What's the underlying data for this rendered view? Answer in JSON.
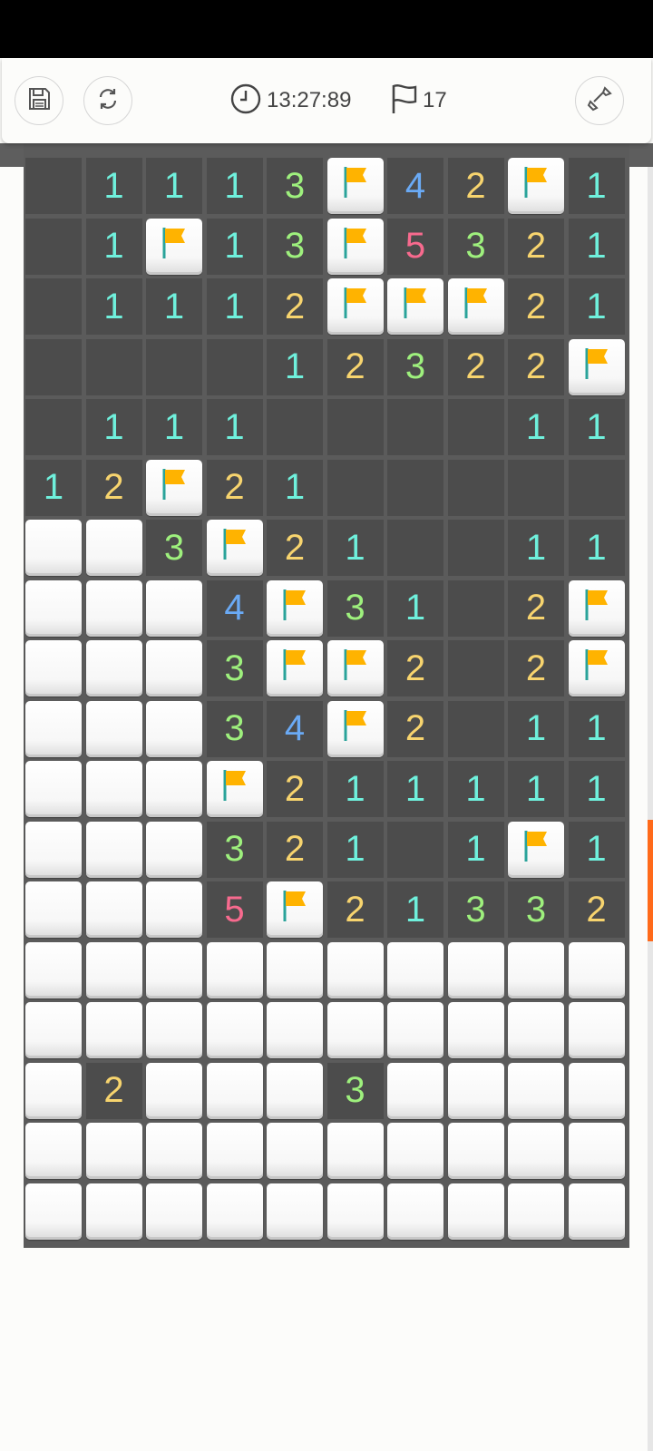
{
  "toolbar": {
    "time": "13:27:89",
    "flag_count": "17"
  },
  "colors": {
    "n1": "#6ff0dc",
    "n2": "#f7d46e",
    "n3": "#9ef07d",
    "n4": "#6aaaf5",
    "n5": "#f76a8e",
    "flag": "#ffb300",
    "revealed": "#4c4c4c",
    "grid": "#5b5b5b",
    "scroll_thumb": "#ff6a1a"
  },
  "board": {
    "cols": 10,
    "legend": "R=revealed empty, H=hidden, F=flag, digits=adjacent mine count",
    "rows": [
      [
        "R",
        "1",
        "1",
        "1",
        "3",
        "F",
        "4",
        "2",
        "F",
        "1"
      ],
      [
        "R",
        "1",
        "F",
        "1",
        "3",
        "F",
        "5",
        "3",
        "2",
        "1"
      ],
      [
        "R",
        "1",
        "1",
        "1",
        "2",
        "F",
        "F",
        "F",
        "2",
        "1"
      ],
      [
        "R",
        "R",
        "R",
        "R",
        "1",
        "2",
        "3",
        "2",
        "2",
        "F"
      ],
      [
        "R",
        "1",
        "1",
        "1",
        "R",
        "R",
        "R",
        "R",
        "1",
        "1"
      ],
      [
        "1",
        "2",
        "F",
        "2",
        "1",
        "R",
        "R",
        "R",
        "R",
        "R"
      ],
      [
        "H",
        "H",
        "3",
        "F",
        "2",
        "1",
        "R",
        "R",
        "1",
        "1"
      ],
      [
        "H",
        "H",
        "H",
        "4",
        "F",
        "3",
        "1",
        "R",
        "2",
        "F"
      ],
      [
        "H",
        "H",
        "H",
        "3",
        "F",
        "F",
        "2",
        "R",
        "2",
        "F"
      ],
      [
        "H",
        "H",
        "H",
        "3",
        "4",
        "F",
        "2",
        "R",
        "1",
        "1"
      ],
      [
        "H",
        "H",
        "H",
        "F",
        "2",
        "1",
        "1",
        "1",
        "1",
        "1"
      ],
      [
        "H",
        "H",
        "H",
        "3",
        "2",
        "1",
        "R",
        "1",
        "F",
        "1"
      ],
      [
        "H",
        "H",
        "H",
        "5",
        "F",
        "2",
        "1",
        "3",
        "3",
        "2"
      ],
      [
        "H",
        "H",
        "H",
        "H",
        "H",
        "H",
        "H",
        "H",
        "H",
        "H"
      ],
      [
        "H",
        "H",
        "H",
        "H",
        "H",
        "H",
        "H",
        "H",
        "H",
        "H"
      ],
      [
        "H",
        "2",
        "H",
        "H",
        "H",
        "3",
        "H",
        "H",
        "H",
        "H"
      ],
      [
        "H",
        "H",
        "H",
        "H",
        "H",
        "H",
        "H",
        "H",
        "H",
        "H"
      ],
      [
        "H",
        "H",
        "H",
        "H",
        "H",
        "H",
        "H",
        "H",
        "H",
        "H"
      ]
    ]
  }
}
